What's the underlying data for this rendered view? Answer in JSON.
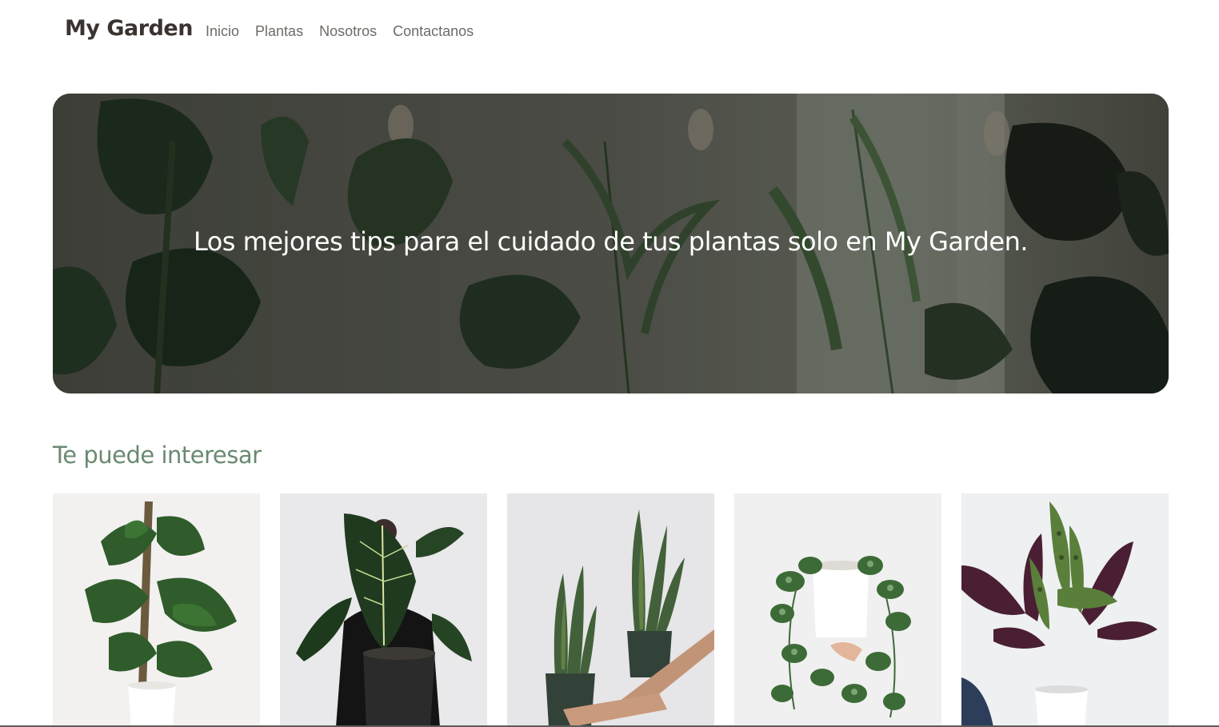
{
  "navbar": {
    "brand": "My Garden",
    "links": [
      {
        "label": "Inicio"
      },
      {
        "label": "Plantas"
      },
      {
        "label": "Nosotros"
      },
      {
        "label": "Contactanos"
      }
    ]
  },
  "hero": {
    "title": "Los mejores tips para el cuidado de tus plantas solo en My Garden."
  },
  "featured": {
    "title": "Te puede interesar",
    "cards": [
      {
        "image": "monstera-plant-image"
      },
      {
        "image": "alocasia-plant-image"
      },
      {
        "image": "snake-plants-image"
      },
      {
        "image": "pothos-plant-image"
      },
      {
        "image": "calathea-plant-image"
      }
    ]
  },
  "colors": {
    "brand_text": "#3a3330",
    "nav_text": "#6f6a66",
    "section_title": "#6a8a72"
  }
}
